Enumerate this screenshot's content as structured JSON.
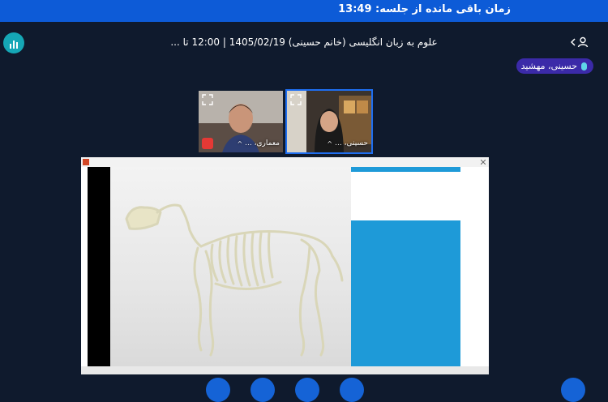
{
  "topbar": {
    "timer_text": "زمان باقی مانده از جلسه: 13:49"
  },
  "header": {
    "session_title": "علوم به زبان انگلیسی (خانم حسینی) 1405/02/19 | 12:00 تا ..."
  },
  "speaker": {
    "name": "حسینی، مهشید"
  },
  "participants": [
    {
      "label": "معماری، ..."
    },
    {
      "label": "حسینی، ..."
    }
  ],
  "colors": {
    "accent": "#0d5bd7",
    "background": "#0f1a2d",
    "speaker_badge": "#3b2aa8"
  },
  "icons": [
    "stats-icon",
    "user-icon",
    "chevron-left-icon",
    "mic-icon",
    "expand-icon",
    "record-icon",
    "chevron-up-icon"
  ]
}
